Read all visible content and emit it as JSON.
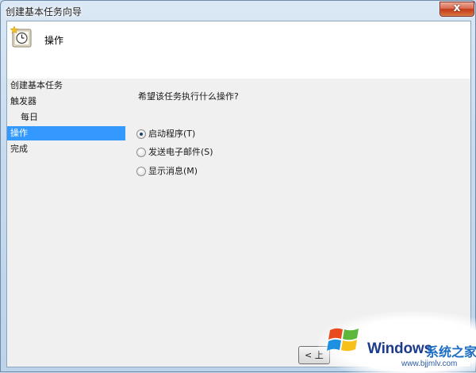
{
  "window": {
    "title": "创建基本任务向导",
    "close_symbol": "x"
  },
  "header": {
    "title": "操作",
    "icon": "task-scheduler-clock-icon"
  },
  "nav": {
    "items": [
      {
        "label": "创建基本任务",
        "selected": false,
        "sub": false
      },
      {
        "label": "触发器",
        "selected": false,
        "sub": false
      },
      {
        "label": "每日",
        "selected": false,
        "sub": true
      },
      {
        "label": "操作",
        "selected": true,
        "sub": false
      },
      {
        "label": "完成",
        "selected": false,
        "sub": false
      }
    ]
  },
  "main": {
    "question": "希望该任务执行什么操作?",
    "options": [
      {
        "label": "启动程序(T)",
        "checked": true
      },
      {
        "label": "发送电子邮件(S)",
        "checked": false
      },
      {
        "label": "显示消息(M)",
        "checked": false
      }
    ]
  },
  "footer": {
    "back_label": "< 上"
  },
  "watermark": {
    "brand": "Windows",
    "brand_cn": "系统之家",
    "url": "www.bjjmlv.com"
  },
  "colors": {
    "selection": "#3399ff",
    "content_bg": "#f0f0f0",
    "header_bg": "#ffffff"
  }
}
